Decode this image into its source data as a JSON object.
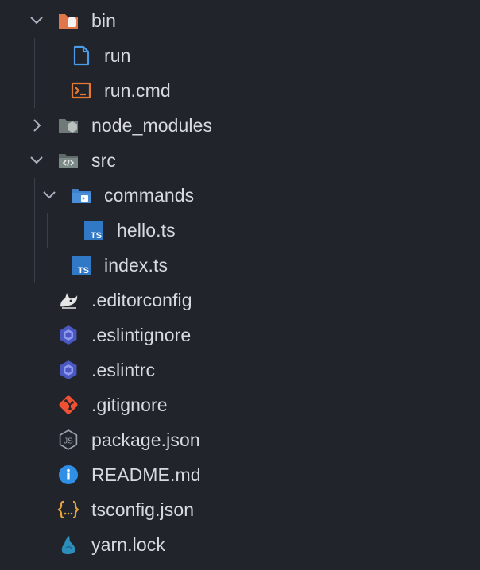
{
  "explorer": {
    "items": [
      {
        "label": "bin",
        "depth": 0,
        "kind": "folder",
        "expanded": true,
        "icon": "folder-bin-icon"
      },
      {
        "label": "run",
        "depth": 1,
        "kind": "file",
        "icon": "file-icon"
      },
      {
        "label": "run.cmd",
        "depth": 1,
        "kind": "file",
        "icon": "terminal-icon"
      },
      {
        "label": "node_modules",
        "depth": 0,
        "kind": "folder",
        "expanded": false,
        "icon": "folder-node-icon"
      },
      {
        "label": "src",
        "depth": 0,
        "kind": "folder",
        "expanded": true,
        "icon": "folder-src-icon"
      },
      {
        "label": "commands",
        "depth": 1,
        "kind": "folder",
        "expanded": true,
        "icon": "folder-commands-icon"
      },
      {
        "label": "hello.ts",
        "depth": 2,
        "kind": "file",
        "icon": "typescript-icon"
      },
      {
        "label": "index.ts",
        "depth": 1,
        "kind": "file",
        "icon": "typescript-icon"
      },
      {
        "label": ".editorconfig",
        "depth": 0,
        "kind": "file",
        "icon": "editorconfig-icon"
      },
      {
        "label": ".eslintignore",
        "depth": 0,
        "kind": "file",
        "icon": "eslint-icon"
      },
      {
        "label": ".eslintrc",
        "depth": 0,
        "kind": "file",
        "icon": "eslint-icon"
      },
      {
        "label": ".gitignore",
        "depth": 0,
        "kind": "file",
        "icon": "git-icon"
      },
      {
        "label": "package.json",
        "depth": 0,
        "kind": "file",
        "icon": "nodejs-icon"
      },
      {
        "label": "README.md",
        "depth": 0,
        "kind": "file",
        "icon": "info-icon"
      },
      {
        "label": "tsconfig.json",
        "depth": 0,
        "kind": "file",
        "icon": "json-icon"
      },
      {
        "label": "yarn.lock",
        "depth": 0,
        "kind": "file",
        "icon": "yarn-icon"
      }
    ]
  },
  "colors": {
    "background": "#21252b",
    "text": "#d7dae0",
    "chevron": "#abb2bf",
    "guide": "#3b4048",
    "folder_orange": "#e0764a",
    "folder_gray": "#7c8a87",
    "folder_blue": "#4a8ed8",
    "file_blue": "#4a9be8",
    "terminal_orange": "#e37933",
    "typescript_blue": "#3178c6",
    "eslint_blue": "#4b58c2",
    "git_orange": "#f05133",
    "info_blue": "#2f8ee6",
    "json_orange": "#e8a33d",
    "yarn_blue": "#2c8ebb"
  }
}
